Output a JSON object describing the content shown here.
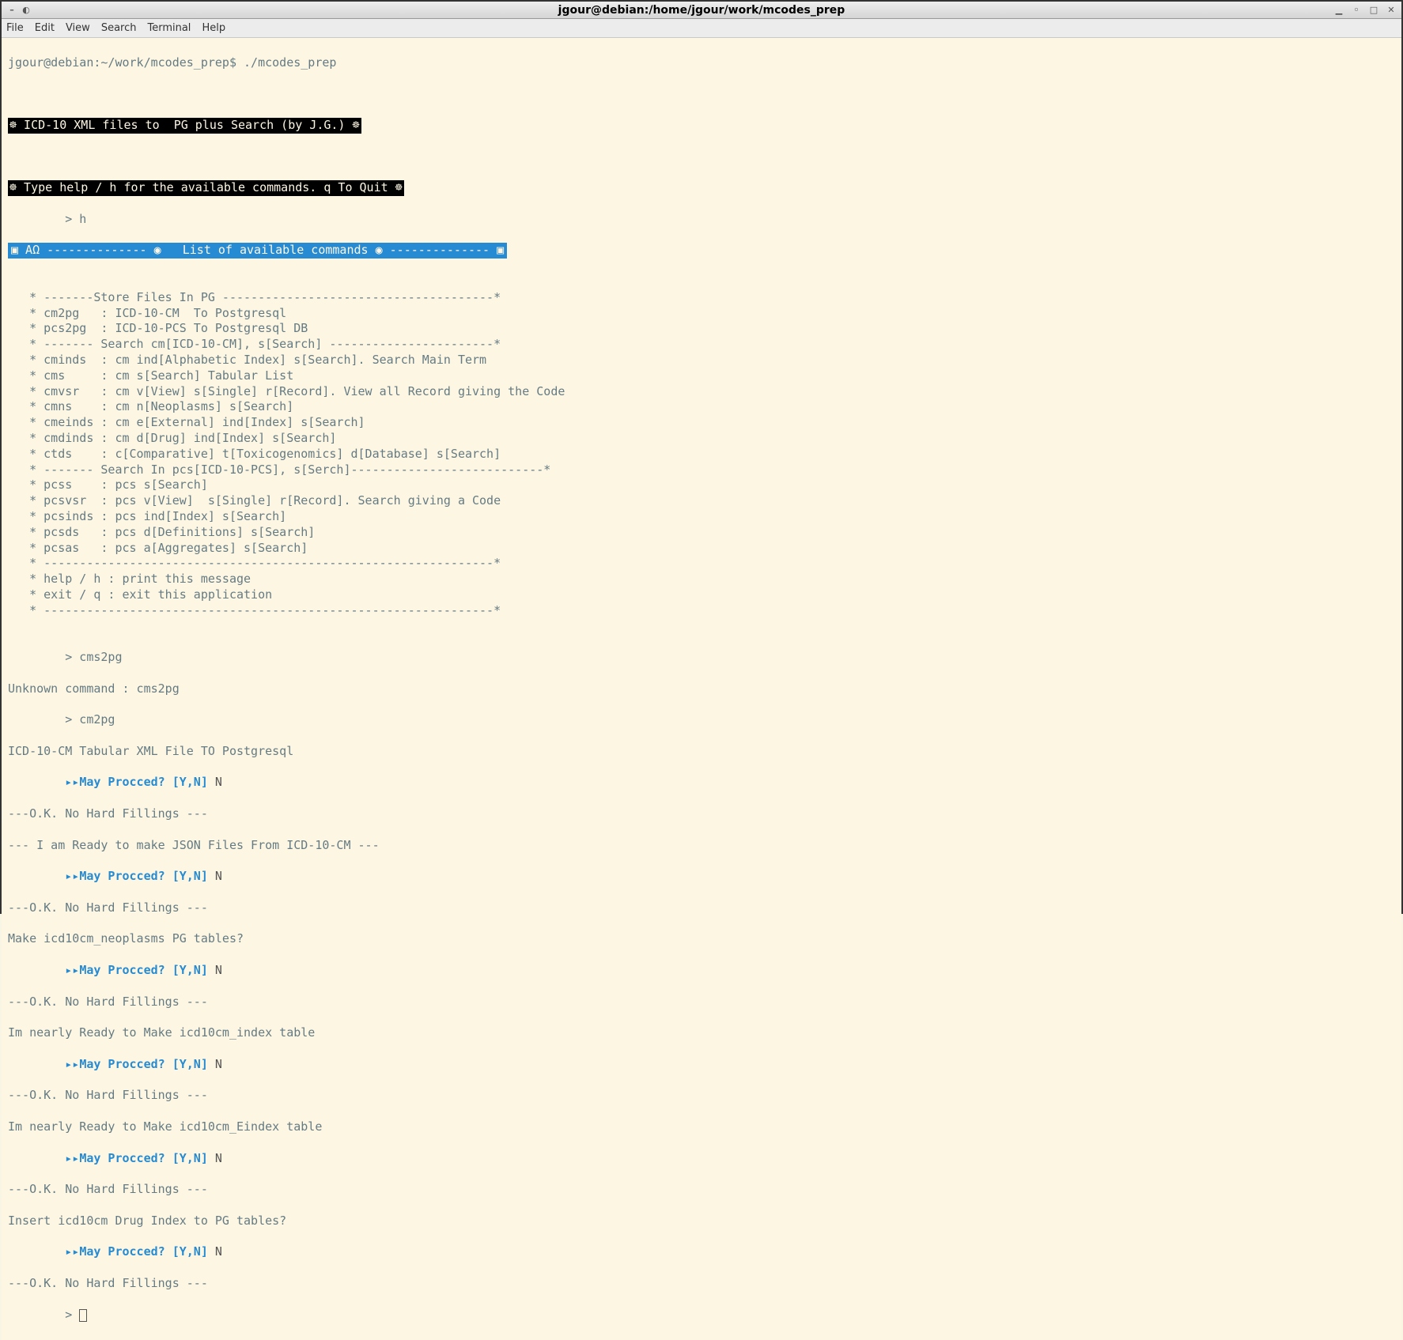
{
  "window": {
    "title": "jgour@debian:/home/jgour/work/mcodes_prep"
  },
  "menu": {
    "file": "File",
    "edit": "Edit",
    "view": "View",
    "search": "Search",
    "terminal": "Terminal",
    "help": "Help"
  },
  "shell_prompt": "jgour@debian:~/work/mcodes_prep$ ./mcodes_prep",
  "banner_title": "☸ ICD-10 XML files to  PG plus Search (by J.G.) ☸",
  "banner_help": "☸ Type help / h for the available commands. q To Quit ☸",
  "input_h": "        > h",
  "cmdlist_header": "▣ ΑΩ -------------- ◉   List of available commands ◉ -------------- ▣",
  "help_lines": [
    "",
    "   * -------Store Files In PG --------------------------------------*",
    "   * cm2pg   : ICD-10-CM  To Postgresql",
    "   * pcs2pg  : ICD-10-PCS To Postgresql DB",
    "   * ------- Search cm[ICD-10-CM], s[Search] -----------------------*",
    "   * cminds  : cm ind[Alphabetic Index] s[Search]. Search Main Term",
    "   * cms     : cm s[Search] Tabular List",
    "   * cmvsr   : cm v[View] s[Single] r[Record]. View all Record giving the Code",
    "   * cmns    : cm n[Neoplasms] s[Search]",
    "   * cmeinds : cm e[External] ind[Index] s[Search]",
    "   * cmdinds : cm d[Drug] ind[Index] s[Search]",
    "   * ctds    : c[Comparative] t[Toxicogenomics] d[Database] s[Search]",
    "   * ------- Search In pcs[ICD-10-PCS], s[Serch]---------------------------*",
    "   * pcss    : pcs s[Search]",
    "   * pcsvsr  : pcs v[View]  s[Single] r[Record]. Search giving a Code",
    "   * pcsinds : pcs ind[Index] s[Search]",
    "   * pcsds   : pcs d[Definitions] s[Search]",
    "   * pcsas   : pcs a[Aggregates] s[Search]",
    "   * ---------------------------------------------------------------*",
    "   * help / h : print this message",
    "   * exit / q : exit this application",
    "   * ---------------------------------------------------------------*",
    ""
  ],
  "interaction": {
    "prompt2": "        > cms2pg",
    "unknown": "Unknown command : cms2pg",
    "prompt3": "        > cm2pg",
    "title_line": "ICD-10-CM Tabular XML File TO Postgresql",
    "proceed_prefix": "        ",
    "proceed_arrows": "▸▸",
    "proceed_text": "May Procced? [Y,N]",
    "answer_n": " N",
    "ok_line": "---O.K. No Hard Fillings ---",
    "json_ready": "--- I am Ready to make JSON Files From ICD-10-CM ---",
    "neoplasms": "Make icd10cm_neoplasms PG tables?",
    "index_table": "Im nearly Ready to Make icd10cm_index table",
    "eindex_table": "Im nearly Ready to Make icd10cm_Eindex table",
    "drug_index": "Insert icd10cm Drug Index to PG tables?",
    "final_prompt": "        > "
  }
}
